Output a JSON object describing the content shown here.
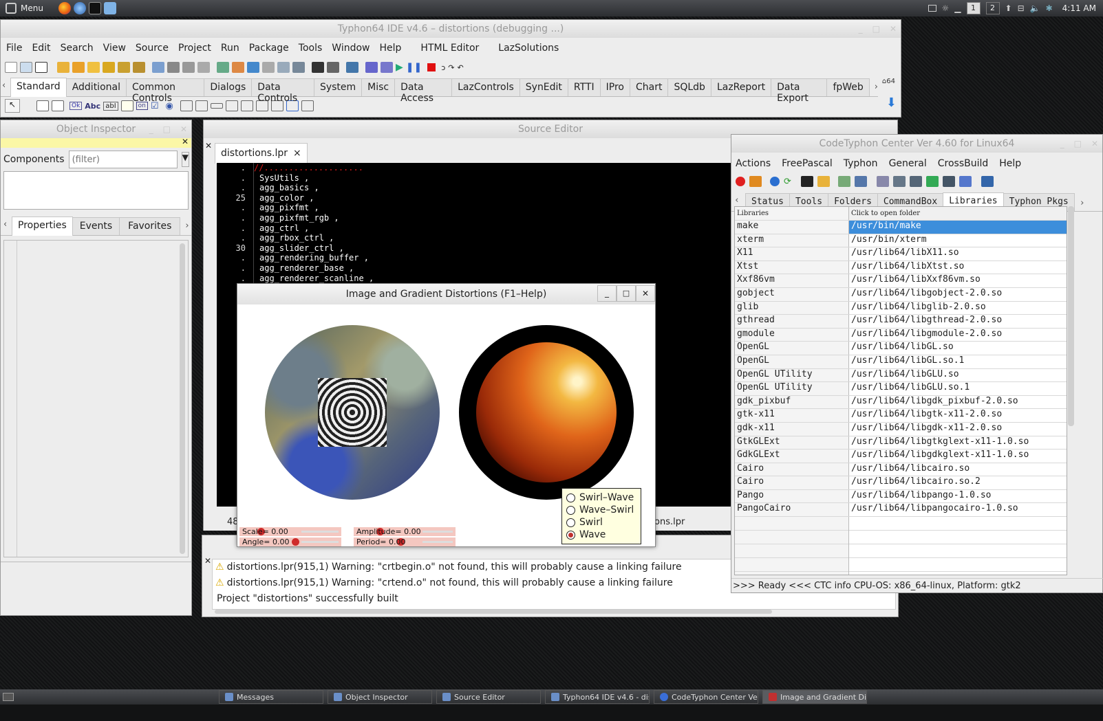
{
  "top_panel": {
    "menu_label": "Menu",
    "workspaces": [
      "1",
      "2"
    ],
    "clock": "4:11 AM"
  },
  "ide": {
    "title": "Typhon64 IDE v4.6 – distortions (debugging ...)",
    "menus": [
      "File",
      "Edit",
      "Search",
      "View",
      "Source",
      "Project",
      "Run",
      "Package",
      "Tools",
      "Window",
      "Help",
      "HTML Editor",
      "LazSolutions"
    ],
    "palette_tabs": [
      "Standard",
      "Additional",
      "Common Controls",
      "Dialogs",
      "Data Controls",
      "System",
      "Misc",
      "Data Access",
      "LazControls",
      "SynEdit",
      "RTTI",
      "IPro",
      "Chart",
      "SQLdb",
      "LazReport",
      "Data Export",
      "fpWeb"
    ],
    "component_icons": [
      "Ok",
      "Abc",
      "abI",
      "on"
    ]
  },
  "object_inspector": {
    "title": "Object Inspector",
    "components_label": "Components",
    "filter_placeholder": "(filter)",
    "tabs": [
      "Properties",
      "Events",
      "Favorites"
    ]
  },
  "source_editor": {
    "title": "Source Editor",
    "file_tab": "distortions.lpr",
    "close_glyph": "×",
    "lines": [
      {
        "gutter": ".",
        "text": "//...................."
      },
      {
        "gutter": ".",
        "text": "SysUtils ,"
      },
      {
        "gutter": ".",
        "text": "agg_basics ,"
      },
      {
        "gutter": "25",
        "text": "agg_color ,"
      },
      {
        "gutter": ".",
        "text": "agg_pixfmt ,"
      },
      {
        "gutter": ".",
        "text": "agg_pixfmt_rgb ,"
      },
      {
        "gutter": ".",
        "text": "agg_ctrl ,"
      },
      {
        "gutter": ".",
        "text": "agg_rbox_ctrl ,"
      },
      {
        "gutter": "30",
        "text": "agg_slider_ctrl ,"
      },
      {
        "gutter": ".",
        "text": "agg_rendering_buffer ,"
      },
      {
        "gutter": ".",
        "text": "agg_renderer_base ,"
      },
      {
        "gutter": ".",
        "text": "agg_renderer_scanline ,"
      }
    ],
    "status_left": "48",
    "status_right": "ons.lpr"
  },
  "messages": {
    "lines": [
      "distortions.lpr(915,1) Warning: \"crtbegin.o\" not found, this will probably cause a linking failure",
      "distortions.lpr(915,1) Warning: \"crtend.o\" not found, this will probably cause a linking failure",
      "Project \"distortions\" successfully built"
    ]
  },
  "distortion_window": {
    "title": "Image and Gradient Distortions (F1–Help)",
    "sliders": {
      "scale": "Scale=    0.00",
      "angle": "Angle=    0.00",
      "amplitude": "Amplitude=    0.00",
      "period": "Period=    0.00"
    },
    "modes": [
      "Swirl–Wave",
      "Wave–Swirl",
      "Swirl",
      "Wave"
    ],
    "selected_mode": "Wave"
  },
  "ctc": {
    "title": "CodeTyphon Center Ver 4.60 for Linux64",
    "menus": [
      "Actions",
      "FreePascal",
      "Typhon",
      "General",
      "CrossBuild",
      "Help"
    ],
    "tabs": [
      "Status",
      "Tools",
      "Folders",
      "CommandBox",
      "Libraries",
      "Typhon Pkgs"
    ],
    "header": {
      "col1": "Libraries",
      "col2": "Click to open folder"
    },
    "rows": [
      [
        "make",
        "/usr/bin/make"
      ],
      [
        "xterm",
        "/usr/bin/xterm"
      ],
      [
        "X11",
        "/usr/lib64/libX11.so"
      ],
      [
        "Xtst",
        "/usr/lib64/libXtst.so"
      ],
      [
        "Xxf86vm",
        "/usr/lib64/libXxf86vm.so"
      ],
      [
        "gobject",
        "/usr/lib64/libgobject-2.0.so"
      ],
      [
        "glib",
        "/usr/lib64/libglib-2.0.so"
      ],
      [
        "gthread",
        "/usr/lib64/libgthread-2.0.so"
      ],
      [
        "gmodule",
        "/usr/lib64/libgmodule-2.0.so"
      ],
      [
        "OpenGL",
        "/usr/lib64/libGL.so"
      ],
      [
        "OpenGL",
        "/usr/lib64/libGL.so.1"
      ],
      [
        "OpenGL UTility",
        "/usr/lib64/libGLU.so"
      ],
      [
        "OpenGL UTility",
        "/usr/lib64/libGLU.so.1"
      ],
      [
        "gdk_pixbuf",
        "/usr/lib64/libgdk_pixbuf-2.0.so"
      ],
      [
        "gtk-x11",
        "/usr/lib64/libgtk-x11-2.0.so"
      ],
      [
        "gdk-x11",
        "/usr/lib64/libgdk-x11-2.0.so"
      ],
      [
        "GtkGLExt",
        "/usr/lib64/libgtkglext-x11-1.0.so"
      ],
      [
        "GdkGLExt",
        "/usr/lib64/libgdkglext-x11-1.0.so"
      ],
      [
        "Cairo",
        "/usr/lib64/libcairo.so"
      ],
      [
        "Cairo",
        "/usr/lib64/libcairo.so.2"
      ],
      [
        "Pango",
        "/usr/lib64/libpango-1.0.so"
      ],
      [
        "PangoCairo",
        "/usr/lib64/libpangocairo-1.0.so"
      ]
    ],
    "status": ">>> Ready <<<  CTC info CPU-OS: x86_64-linux, Platform: gtk2"
  },
  "taskbar": {
    "tasks": [
      "Messages",
      "Object Inspector",
      "Source Editor",
      "Typhon64 IDE v4.6 - dis...",
      "CodeTyphon Center Ver...",
      "Image and Gradient Dist..."
    ]
  },
  "colors": {
    "selection": "#3d8edb",
    "accent_red": "#cf2b2b",
    "code_bg": "#000000"
  }
}
